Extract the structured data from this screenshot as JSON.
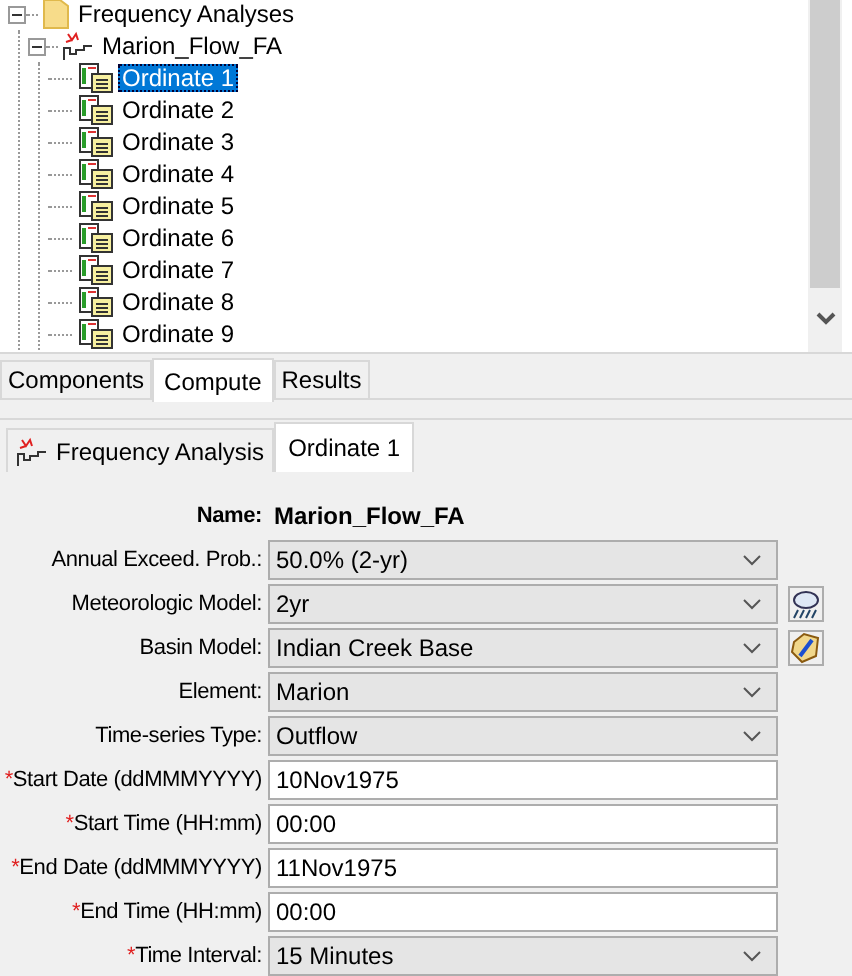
{
  "tree": [
    {
      "label": "Frequency Analyses",
      "kind": "folder",
      "expanded": true,
      "selected": false,
      "children": [
        {
          "label": "Marion_Flow_FA",
          "kind": "analysis",
          "expanded": true,
          "selected": false,
          "children": [
            {
              "label": "Ordinate 1",
              "kind": "ordinate",
              "selected": true
            },
            {
              "label": "Ordinate 2",
              "kind": "ordinate",
              "selected": false
            },
            {
              "label": "Ordinate 3",
              "kind": "ordinate",
              "selected": false
            },
            {
              "label": "Ordinate 4",
              "kind": "ordinate",
              "selected": false
            },
            {
              "label": "Ordinate 5",
              "kind": "ordinate",
              "selected": false
            },
            {
              "label": "Ordinate 6",
              "kind": "ordinate",
              "selected": false
            },
            {
              "label": "Ordinate 7",
              "kind": "ordinate",
              "selected": false
            },
            {
              "label": "Ordinate 8",
              "kind": "ordinate",
              "selected": false
            },
            {
              "label": "Ordinate 9",
              "kind": "ordinate",
              "selected": false
            }
          ]
        }
      ]
    }
  ],
  "tabs": [
    {
      "label": "Components",
      "selected": false
    },
    {
      "label": "Compute",
      "selected": true
    },
    {
      "label": "Results",
      "selected": false
    }
  ],
  "editor_tabs": [
    {
      "label": "Frequency Analysis",
      "kind": "analysis",
      "selected": false
    },
    {
      "label": "Ordinate 1",
      "kind": "plain",
      "selected": true
    }
  ],
  "name": {
    "label": "Name:",
    "value": "Marion_Flow_FA"
  },
  "fields": [
    {
      "label": "Annual Exceed. Prob.:",
      "kind": "select",
      "value": "50.0% (2-yr)"
    },
    {
      "label": "Meteorologic Model:",
      "kind": "select",
      "value": "2yr",
      "side_button": {
        "kind": "weather"
      }
    },
    {
      "label": "Basin Model:",
      "kind": "select",
      "value": "Indian Creek Base",
      "side_button": {
        "kind": "basin"
      }
    },
    {
      "label": "Element:",
      "kind": "select",
      "value": "Marion"
    },
    {
      "label": "Time-series Type:",
      "kind": "select",
      "value": "Outflow"
    },
    {
      "label": "Start Date (ddMMMYYYY)",
      "kind": "text",
      "required_mark": "*",
      "value": "10Nov1975"
    },
    {
      "label": "Start Time (HH:mm)",
      "kind": "text",
      "required_mark": "*",
      "value": "00:00"
    },
    {
      "label": "End Date (ddMMMYYYY)",
      "kind": "text",
      "required_mark": "*",
      "value": "11Nov1975"
    },
    {
      "label": "End Time (HH:mm)",
      "kind": "text",
      "required_mark": "*",
      "value": "00:00"
    },
    {
      "label": "Time Interval:",
      "kind": "select",
      "required_mark": "*",
      "value": "15 Minutes"
    }
  ]
}
